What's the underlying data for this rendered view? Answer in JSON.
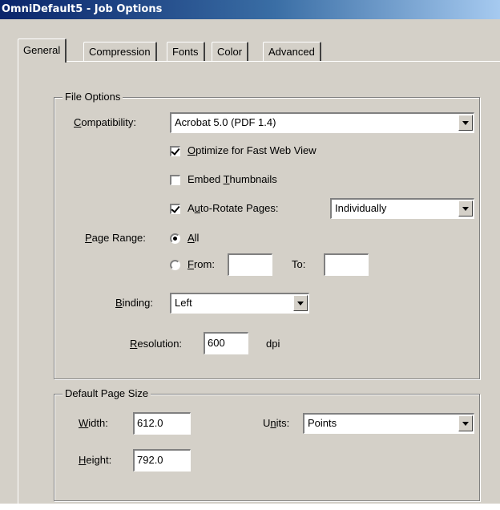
{
  "window": {
    "title": "OmniDefault5 - Job Options"
  },
  "tabs": [
    {
      "label": "General",
      "active": true
    },
    {
      "label": "Compression",
      "active": false
    },
    {
      "label": "Fonts",
      "active": false
    },
    {
      "label": "Color",
      "active": false
    },
    {
      "label": "Advanced",
      "active": false
    }
  ],
  "file_options": {
    "legend": "File Options",
    "compatibility": {
      "label_pre": "",
      "label_key": "C",
      "label_post": "ompatibility:",
      "value": "Acrobat 5.0 (PDF 1.4)"
    },
    "optimize": {
      "label_pre": "",
      "label_key": "O",
      "label_post": "ptimize for Fast Web View",
      "checked": true
    },
    "embed_thumbnails": {
      "label_pre": "Embed ",
      "label_key": "T",
      "label_post": "humbnails",
      "checked": false
    },
    "auto_rotate": {
      "label_pre": "A",
      "label_key": "u",
      "label_post": "to-Rotate Pages:",
      "checked": true,
      "value": "Individually"
    },
    "page_range": {
      "label_pre": "",
      "label_key": "P",
      "label_post": "age Range:",
      "all_pre": "",
      "all_key": "A",
      "all_post": "ll",
      "all_checked": true,
      "from_pre": "",
      "from_key": "F",
      "from_post": "rom:",
      "from_checked": false,
      "from_value": "",
      "to_label": "To:",
      "to_value": ""
    },
    "binding": {
      "label_pre": "",
      "label_key": "B",
      "label_post": "inding:",
      "value": "Left"
    },
    "resolution": {
      "label_pre": "",
      "label_key": "R",
      "label_post": "esolution:",
      "value": "600",
      "unit": "dpi"
    }
  },
  "page_size": {
    "legend": "Default Page Size",
    "width": {
      "label_pre": "",
      "label_key": "W",
      "label_post": "idth:",
      "value": "612.0"
    },
    "height": {
      "label_pre": "",
      "label_key": "H",
      "label_post": "eight:",
      "value": "792.0"
    },
    "units": {
      "label_pre": "U",
      "label_key": "n",
      "label_post": "its:",
      "value": "Points"
    }
  }
}
